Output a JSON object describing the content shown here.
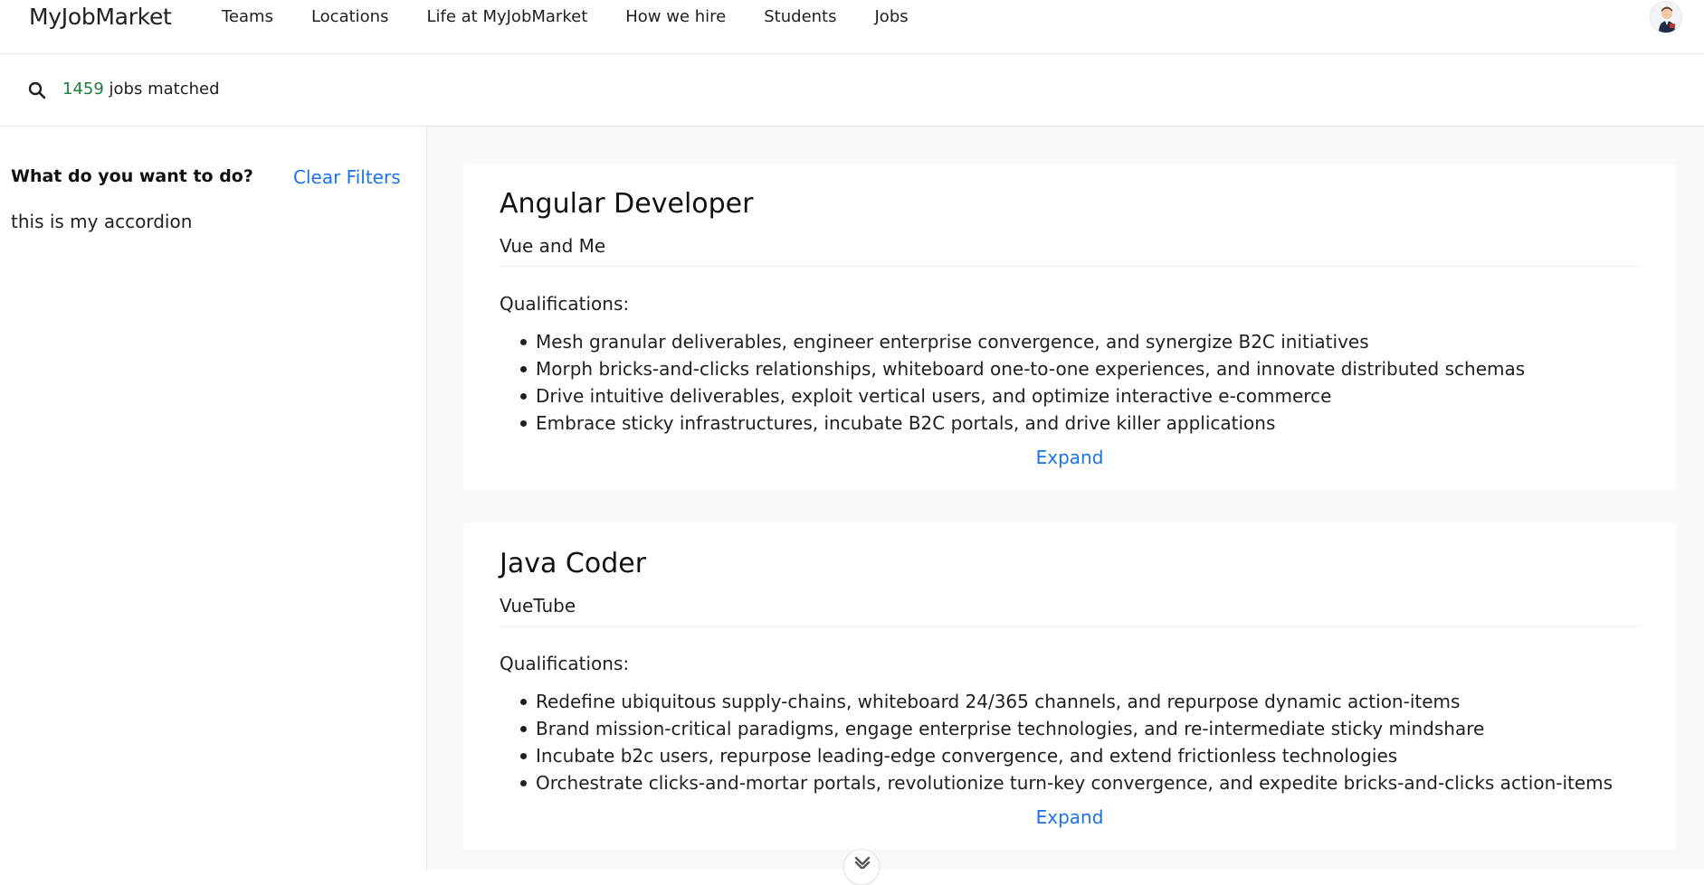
{
  "header": {
    "brand": "MyJobMarket",
    "nav": [
      "Teams",
      "Locations",
      "Life at MyJobMarket",
      "How we hire",
      "Students",
      "Jobs"
    ],
    "avatar_icon": "user-avatar-icon"
  },
  "search": {
    "icon": "search-icon",
    "count": "1459",
    "suffix": " jobs matched"
  },
  "sidebar": {
    "heading": "What do you want to do?",
    "clear_filters": "Clear Filters",
    "accordion_text": "this is my accordion"
  },
  "jobs": [
    {
      "title": "Angular Developer",
      "company": "Vue and Me",
      "qualifications_label": "Qualifications:",
      "qualifications": [
        "Mesh granular deliverables, engineer enterprise convergence, and synergize B2C initiatives",
        "Morph bricks-and-clicks relationships, whiteboard one-to-one experiences, and innovate distributed schemas",
        "Drive intuitive deliverables, exploit vertical users, and optimize interactive e-commerce",
        "Embrace sticky infrastructures, incubate B2C portals, and drive killer applications"
      ],
      "expand": "Expand"
    },
    {
      "title": "Java Coder",
      "company": "VueTube",
      "qualifications_label": "Qualifications:",
      "qualifications": [
        "Redefine ubiquitous supply-chains, whiteboard 24/365 channels, and repurpose dynamic action-items",
        "Brand mission-critical paradigms, engage enterprise technologies, and re-intermediate sticky mindshare",
        "Incubate b2c users, repurpose leading-edge convergence, and extend frictionless technologies",
        "Orchestrate clicks-and-mortar portals, revolutionize turn-key convergence, and expedite bricks-and-clicks action-items"
      ],
      "expand": "Expand"
    }
  ],
  "colors": {
    "link": "#1a73e8",
    "count": "#1a7f37",
    "main_bg": "#f7f8fa"
  }
}
